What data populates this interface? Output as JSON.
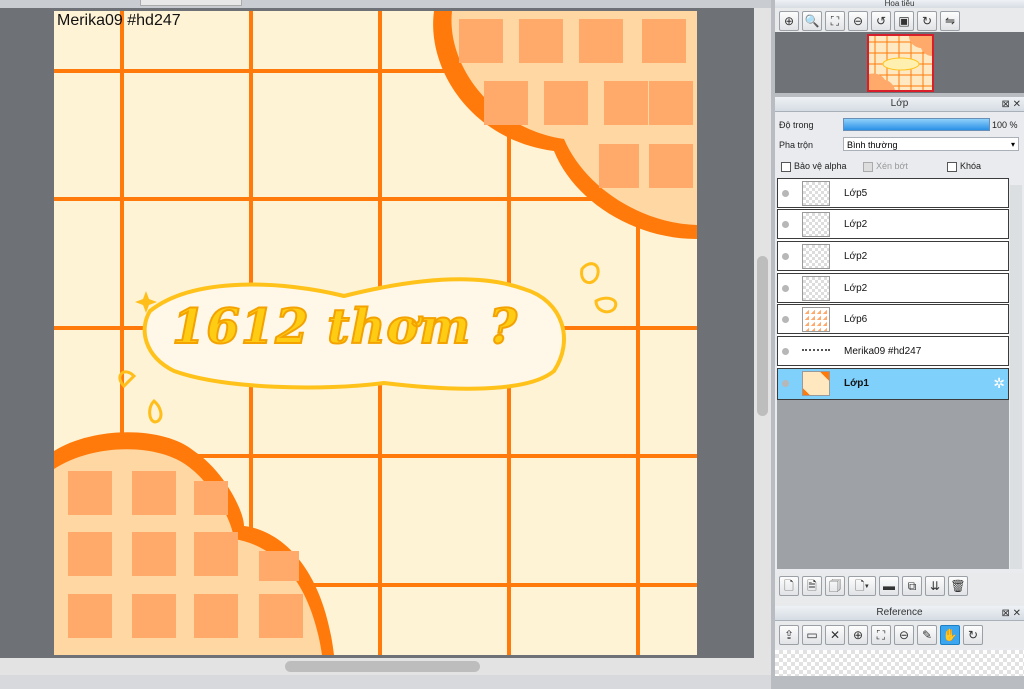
{
  "canvas": {
    "top_tab_label": "",
    "artwork_label": "Merika09 #hd247",
    "artwork_text": "1612 thơm ?"
  },
  "navigator": {
    "title": "Hoa tiêu",
    "tools": [
      "zoom-in-icon",
      "zoom-plus-icon",
      "fit-icon",
      "zoom-minus-icon",
      "rotate-left-icon",
      "actual-size-icon",
      "rotate-right-icon",
      "flip-icon"
    ]
  },
  "layers": {
    "title": "Lớp",
    "opacity_label": "Độ trong",
    "opacity_value": "100 %",
    "opacity_fraction": 1.0,
    "blend_label": "Pha trộn",
    "blend_value": "Bình thường",
    "protect_alpha": "Bảo vệ alpha",
    "clipping": "Xén bớt",
    "lock": "Khóa",
    "items": [
      {
        "name": "Lớp5",
        "selected": false
      },
      {
        "name": "Lớp2",
        "selected": false
      },
      {
        "name": "Lớp2",
        "selected": false
      },
      {
        "name": "Lớp2",
        "selected": false
      },
      {
        "name": "Lớp6",
        "selected": false
      },
      {
        "name": "Merika09 #hd247",
        "selected": false
      },
      {
        "name": "Lớp1",
        "selected": true
      }
    ]
  },
  "reference": {
    "title": "Reference"
  },
  "colors": {
    "orange": "#ff7a0a",
    "cream": "#fff3d6",
    "peach": "#ffd7a3",
    "tile": "#ffa96b",
    "selected": "#7fd0fb"
  }
}
